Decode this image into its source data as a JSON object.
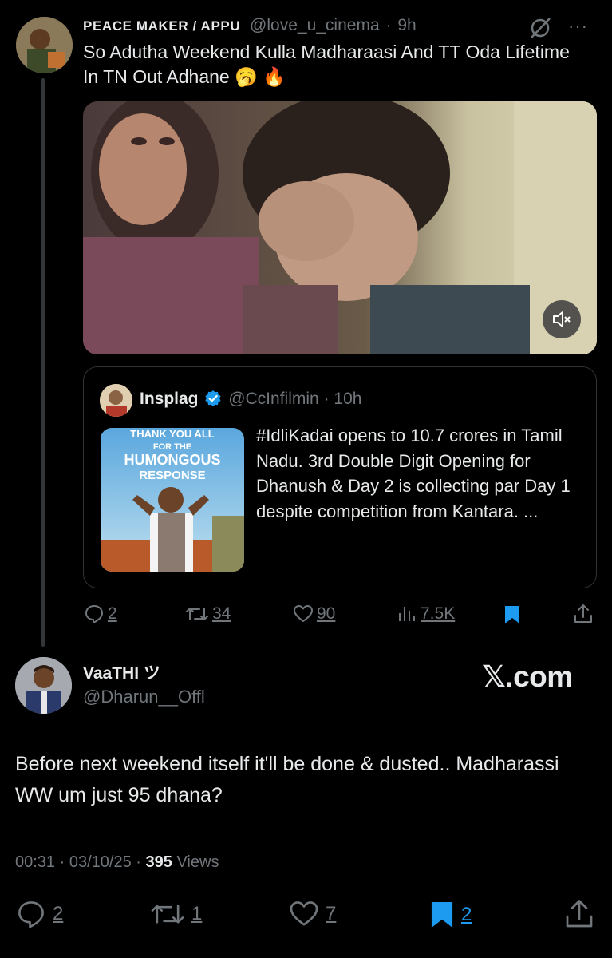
{
  "tweet": {
    "author_name": "PEACE MAKER / APPU",
    "handle": "@love_u_cinema",
    "separator": "·",
    "time": "9h",
    "more": "···",
    "text": "So Adutha Weekend Kulla Madharaasi And TT Oda Lifetime In TN Out Adhane 🥱 🔥",
    "actions": {
      "replies": "2",
      "retweets": "34",
      "likes": "90",
      "views": "7.5K"
    }
  },
  "quote": {
    "author_name": "Insplag",
    "handle": "@CcInfilmin",
    "separator": "·",
    "time": "10h",
    "text": "#IdliKadai opens to 10.7 crores in Tamil Nadu. 3rd Double Digit Opening for Dhanush & Day 2 is collecting par Day 1 despite competition from Kantara. ...",
    "thumb_text_top": "THANK YOU ALL",
    "thumb_text_mid": "FOR THE",
    "thumb_text_big": "HUMONGOUS",
    "thumb_text_big2": "RESPONSE"
  },
  "reply": {
    "author_name": "VaaTHI ツ",
    "handle": "@Dharun__Offl",
    "watermark": "𝕏.com",
    "text": "Before next weekend itself it'll be done & dusted.. Madharassi WW um just 95 dhana?",
    "time": "00:31",
    "date": "03/10/25",
    "views_count": "395",
    "views_label": "Views",
    "dot": "·",
    "actions": {
      "replies": "2",
      "retweets": "1",
      "likes": "7",
      "bookmarks": "2"
    }
  },
  "colors": {
    "background": "#000000",
    "text": "#e7e9ea",
    "muted": "#71767b",
    "accent": "#1d9bf0",
    "border": "#2f3336"
  }
}
